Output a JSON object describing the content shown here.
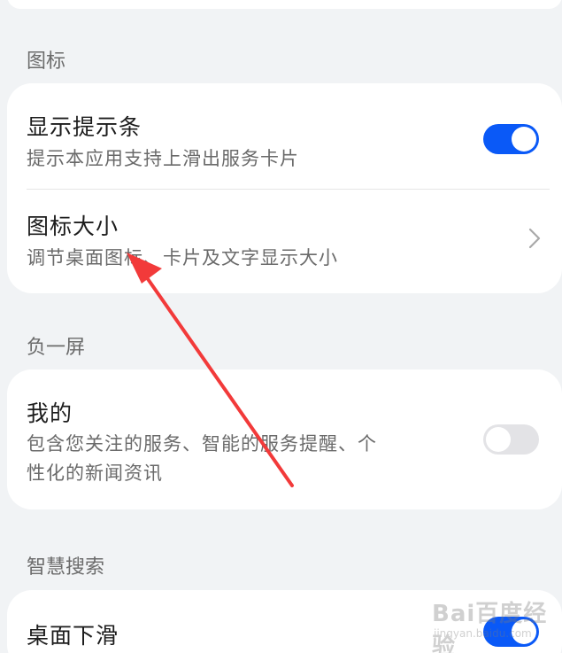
{
  "sections": {
    "icons": {
      "title": "图标",
      "show_hint_bar": {
        "title": "显示提示条",
        "subtitle": "提示本应用支持上滑出服务卡片",
        "enabled": true
      },
      "icon_size": {
        "title": "图标大小",
        "subtitle": "调节桌面图标、卡片及文字显示大小",
        "chevron_icon": "chevron-right-icon"
      }
    },
    "minus_one_screen": {
      "title": "负一屏",
      "mine": {
        "title": "我的",
        "subtitle_line1": "包含您关注的服务、智能的服务提醒、个",
        "subtitle_line2": "性化的新闻资讯",
        "enabled": false
      }
    },
    "smart_search": {
      "title": "智慧搜索",
      "desktop_swipe_down": {
        "title": "桌面下滑",
        "enabled": true
      }
    }
  },
  "annotation": {
    "arrow_color": "#f23a3a"
  },
  "watermark": {
    "text": "Bai百度经验",
    "subtext": "jingyan.baidu.com"
  },
  "colors": {
    "accent": "#0a59f7",
    "background": "#f1f3f5",
    "card": "#ffffff",
    "toggle_off": "#e3e3e6"
  }
}
